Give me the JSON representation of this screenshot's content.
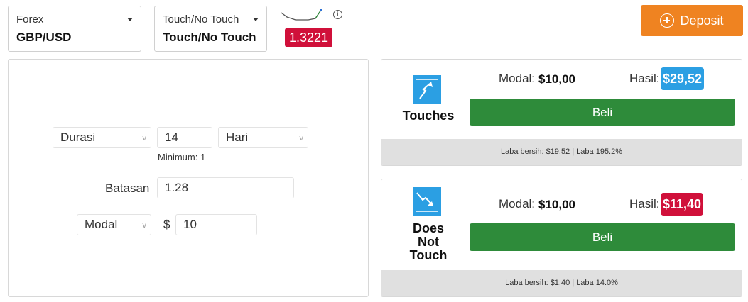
{
  "header": {
    "asset_selector": {
      "category": "Forex",
      "value": "GBP/USD"
    },
    "type_selector": {
      "category": "Touch/No Touch",
      "value": "Touch/No Touch"
    },
    "sparkline_icon": "sparkline-chart",
    "info_icon": "info-circle-icon",
    "current_price": "1.3221",
    "price_color": "#d0103a",
    "deposit": {
      "label": "Deposit",
      "icon": "plus-circle-icon",
      "color": "#ef8321"
    }
  },
  "form": {
    "duration_type": "Durasi",
    "duration_value": "14",
    "duration_unit": "Hari",
    "minimum_note": "Minimum: 1",
    "barrier_label": "Batasan",
    "barrier_value": "1.28",
    "stake_type": "Modal",
    "currency_symbol": "$",
    "stake_value": "10"
  },
  "options": [
    {
      "name": "Touches",
      "icon": "touch-up-arrow-icon",
      "modal_label": "Modal:",
      "modal_value": "$10,00",
      "hasil_label": "Hasil:",
      "hasil_value": "$29,52",
      "hasil_color": "#2b9fe3",
      "buy_label": "Beli",
      "footer": "Laba bersih: $19,52 | Laba 195.2%"
    },
    {
      "name": "Does Not Touch",
      "name_lines": [
        "Does",
        "Not",
        "Touch"
      ],
      "icon": "no-touch-down-arrow-icon",
      "modal_label": "Modal:",
      "modal_value": "$10,00",
      "hasil_label": "Hasil:",
      "hasil_value": "$11,40",
      "hasil_color": "#d0103a",
      "buy_label": "Beli",
      "footer": "Laba bersih: $1,40 | Laba 14.0%"
    }
  ],
  "colors": {
    "buy_button": "#2e8b3a",
    "icon_blue": "#2b9fe3",
    "footer_bg": "#e0e0e0"
  }
}
